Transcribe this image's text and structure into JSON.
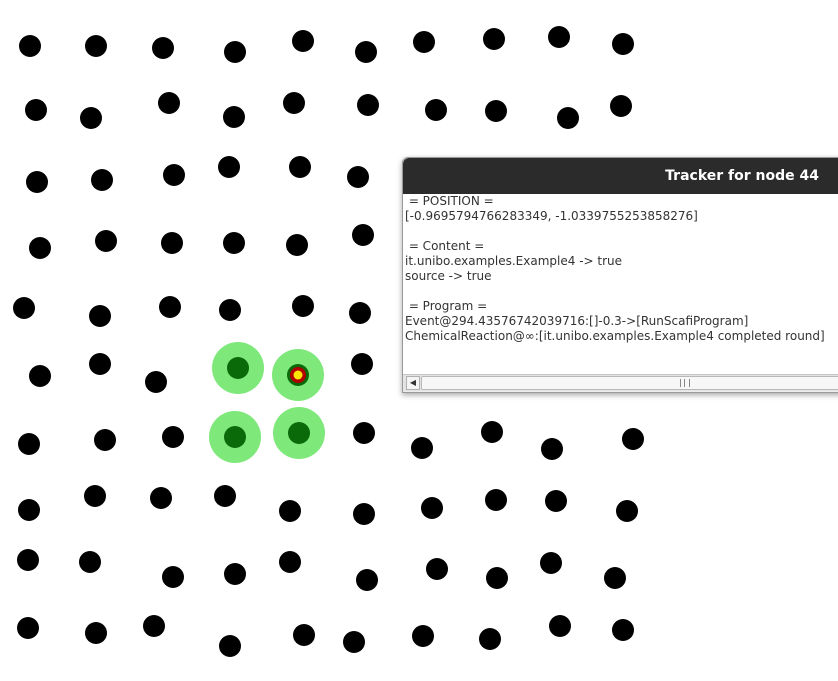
{
  "colors": {
    "background": "#ffffff",
    "node": "#000000",
    "highlight_halo": "#7ee87a",
    "highlight_core": "#0a6a0a",
    "selected_node_outer": "#b00000",
    "selected_node_inner": "#ffe600",
    "window_titlebar": "#2b2b2b"
  },
  "simulation": {
    "highlighted_nodes": 4,
    "selected_node_id": 44
  },
  "tracker": {
    "title": "Tracker for node 44",
    "lines": [
      " = POSITION =",
      "[-0.9695794766283349, -1.0339755253858276]",
      "",
      " = Content =",
      "it.unibo.examples.Example4 -> true",
      "source -> true",
      "",
      " = Program =",
      "Event@294.43576742039716:[]-0.3->[RunScafiProgram]",
      "ChemicalReaction@∞:[it.unibo.examples.Example4 completed round]"
    ]
  }
}
